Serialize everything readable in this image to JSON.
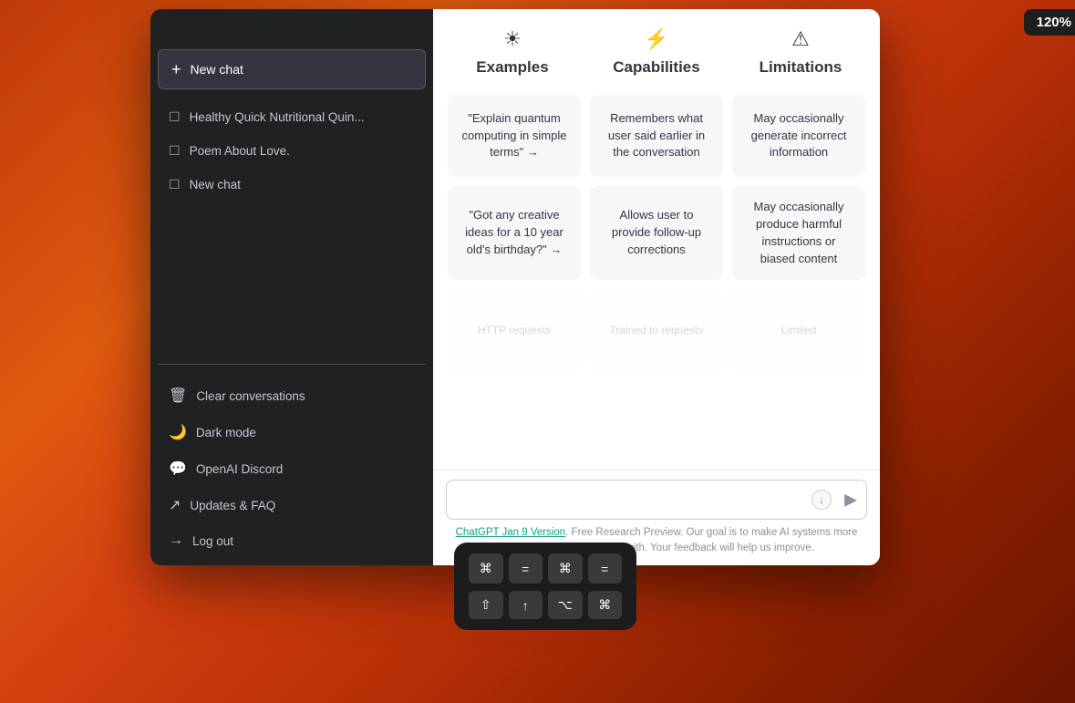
{
  "window": {
    "traffic_lights": [
      "red",
      "yellow",
      "green"
    ]
  },
  "sidebar": {
    "new_chat_label": "New chat",
    "conversations": [
      {
        "label": "Healthy Quick Nutritional Quin..."
      },
      {
        "label": "Poem About Love."
      },
      {
        "label": "New chat"
      }
    ],
    "actions": [
      {
        "icon": "🗑",
        "label": "Clear conversations"
      },
      {
        "icon": "🌙",
        "label": "Dark mode"
      },
      {
        "icon": "💬",
        "label": "OpenAI Discord"
      },
      {
        "icon": "↗",
        "label": "Updates & FAQ"
      },
      {
        "icon": "→",
        "label": "Log out"
      }
    ]
  },
  "main": {
    "columns": [
      {
        "icon": "☀",
        "title": "Examples",
        "cards": [
          {
            "text": "\"Explain quantum computing in simple terms\" →"
          },
          {
            "text": "\"Got any creative ideas for a 10 year old's birthday?\" →"
          },
          {
            "text": "HTTP requests",
            "faded": true
          }
        ]
      },
      {
        "icon": "⚡",
        "title": "Capabilities",
        "cards": [
          {
            "text": "Remembers what user said earlier in the conversation"
          },
          {
            "text": "Allows user to provide follow-up corrections"
          },
          {
            "text": "Trained to requests",
            "faded": true
          }
        ]
      },
      {
        "icon": "⚠",
        "title": "Limitations",
        "cards": [
          {
            "text": "May occasionally generate incorrect information"
          },
          {
            "text": "May occasionally produce harmful instructions or biased content"
          },
          {
            "text": "Limited",
            "faded": true
          }
        ]
      }
    ],
    "input_placeholder": "",
    "footer": {
      "link_text": "ChatGPT Jan 9 Version",
      "description": ". Free Research Preview. Our goal is to make AI systems more natural and safe to interact with. Your feedback will help us improve."
    }
  },
  "zoom_badge": "120%",
  "keyboard": {
    "row1": [
      "⌘",
      "=",
      "⌘",
      "="
    ],
    "row2": [
      "⇧",
      "↑",
      "⌥",
      "⌘"
    ]
  }
}
